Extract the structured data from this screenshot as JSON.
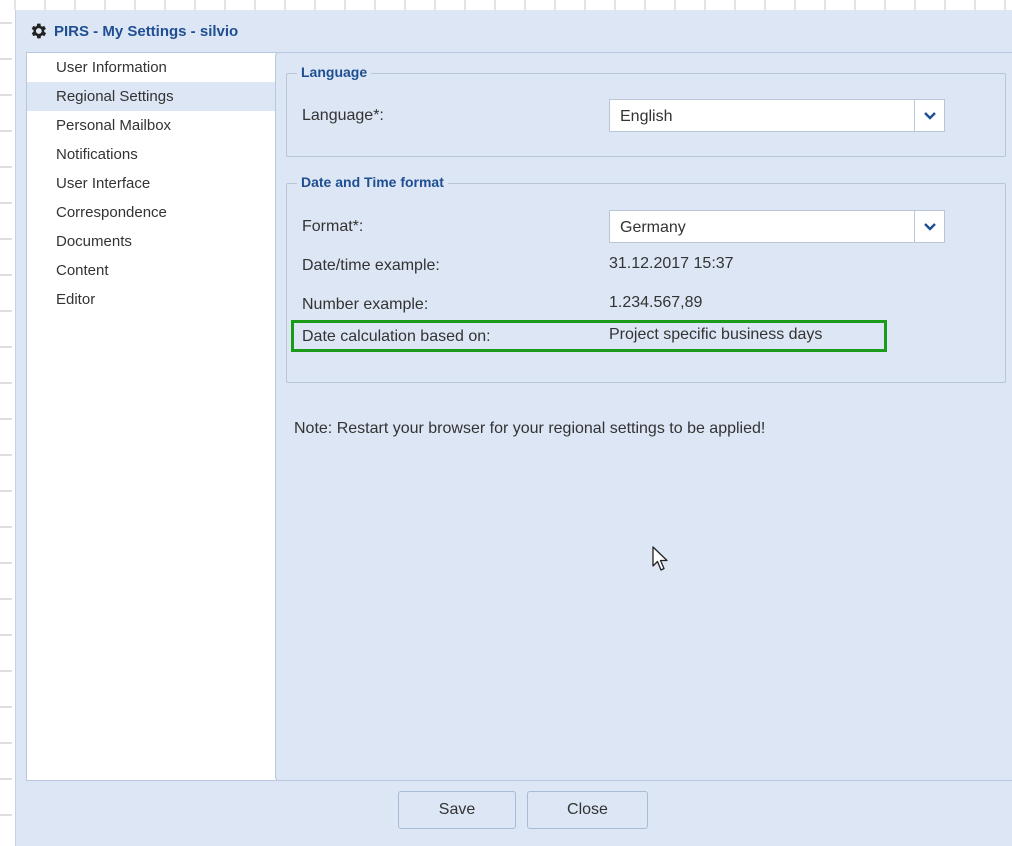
{
  "window": {
    "title": "PIRS - My Settings - silvio",
    "icon": "gear-icon"
  },
  "sidebar": {
    "items": [
      {
        "label": "User Information",
        "selected": false
      },
      {
        "label": "Regional Settings",
        "selected": true
      },
      {
        "label": "Personal Mailbox",
        "selected": false
      },
      {
        "label": "Notifications",
        "selected": false
      },
      {
        "label": "User Interface",
        "selected": false
      },
      {
        "label": "Correspondence",
        "selected": false
      },
      {
        "label": "Documents",
        "selected": false
      },
      {
        "label": "Content",
        "selected": false
      },
      {
        "label": "Editor",
        "selected": false
      }
    ]
  },
  "language_section": {
    "legend": "Language",
    "language_label": "Language*:",
    "language_value": "English"
  },
  "datetime_section": {
    "legend": "Date and Time format",
    "format_label": "Format*:",
    "format_value": "Germany",
    "date_example_label": "Date/time example:",
    "date_example_value": "31.12.2017 15:37",
    "number_example_label": "Number example:",
    "number_example_value": "1.234.567,89",
    "date_calc_label": "Date calculation based on:",
    "date_calc_value": "Project specific business days"
  },
  "note": "Note: Restart your browser for your regional settings to be applied!",
  "footer": {
    "save_label": "Save",
    "close_label": "Close"
  },
  "colors": {
    "title": "#1f4f92",
    "panel_bg": "#dce6f4",
    "highlight_border": "#1a9c1a"
  }
}
